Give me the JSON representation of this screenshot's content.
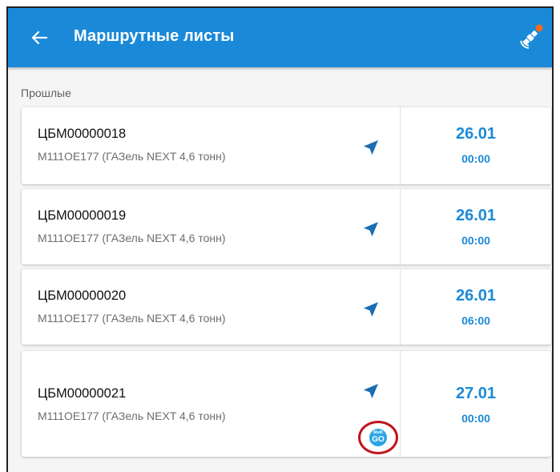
{
  "header": {
    "title": "Маршрутные листы",
    "back_icon": "arrow-left-icon",
    "gps_icon": "satellite-icon",
    "accent_color": "#1a8ad8",
    "gps_status_color": "#f26b21"
  },
  "section": {
    "label": "Прошлые"
  },
  "route_sheets": [
    {
      "number": "ЦБМ00000018",
      "vehicle": "М111ОЕ177 (ГАЗель NEXT 4,6 тонн)",
      "date": "26.01",
      "time": "00:00"
    },
    {
      "number": "ЦБМ00000019",
      "vehicle": "М111ОЕ177 (ГАЗель NEXT 4,6 тонн)",
      "date": "26.01",
      "time": "00:00"
    },
    {
      "number": "ЦБМ00000020",
      "vehicle": "М111ОЕ177 (ГАЗель NEXT 4,6 тонн)",
      "date": "26.01",
      "time": "06:00"
    },
    {
      "number": "ЦБМ00000021",
      "vehicle": "М111ОЕ177 (ГАЗель NEXT 4,6 тонн)",
      "date": "27.01",
      "time": "00:00",
      "badge": {
        "top": "Multi",
        "bottom": "GO"
      }
    }
  ]
}
